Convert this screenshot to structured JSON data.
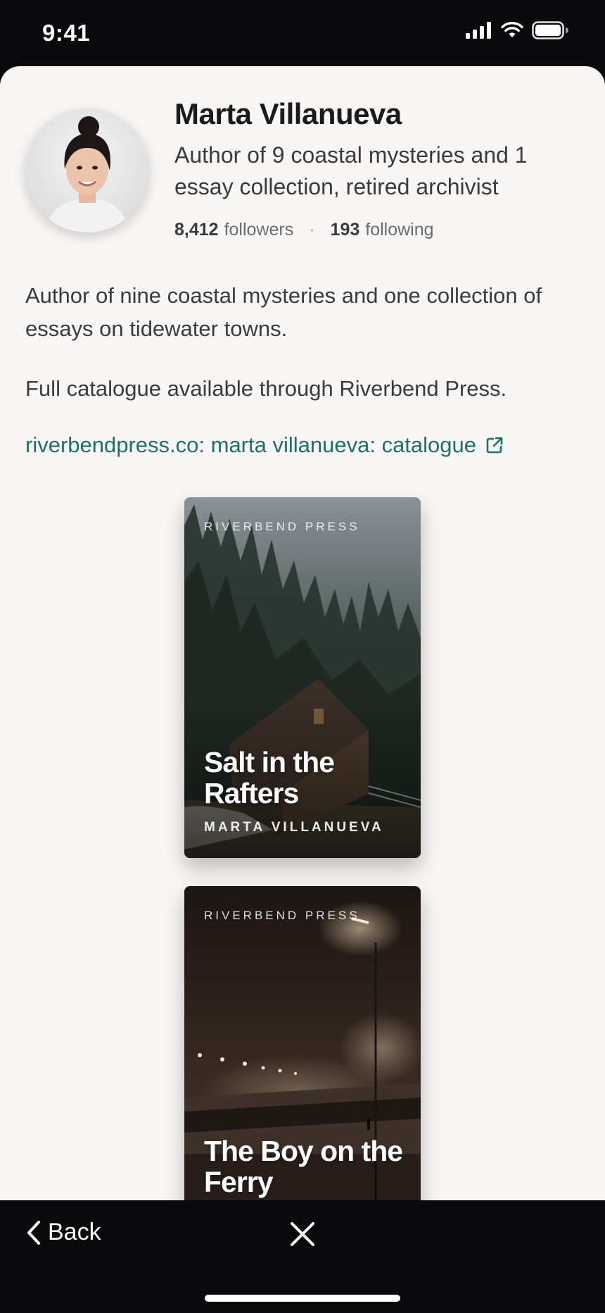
{
  "status_bar": {
    "time": "9:41"
  },
  "profile": {
    "name": "Marta Villanueva",
    "tagline": "Author of 9 coastal mysteries and 1 essay collection, retired archivist",
    "followers_count": "8,412",
    "followers_label": "followers",
    "separator": "·",
    "following_count": "193",
    "following_label": "following"
  },
  "bio": {
    "paragraph_1": "Author of nine coastal mysteries and one collection of essays on tidewater towns.",
    "paragraph_2": "Full catalogue available through Riverbend Press."
  },
  "catalogue_link": {
    "text": "riverbendpress.co: marta villanueva: catalogue",
    "icon": "external-link-icon"
  },
  "books": [
    {
      "publisher": "RIVERBEND PRESS",
      "title": "Salt in the Rafters",
      "author": "MARTA VILLANUEVA"
    },
    {
      "publisher": "RIVERBEND PRESS",
      "title": "The Boy on the Ferry"
    }
  ],
  "bottom_bar": {
    "back_label": "Back",
    "back_icon": "chevron-left-icon",
    "close_icon": "close-icon"
  },
  "colors": {
    "link": "#1f6f63",
    "sheet_bg": "#f8f7f5",
    "chrome_bg": "#0a0a0c"
  }
}
